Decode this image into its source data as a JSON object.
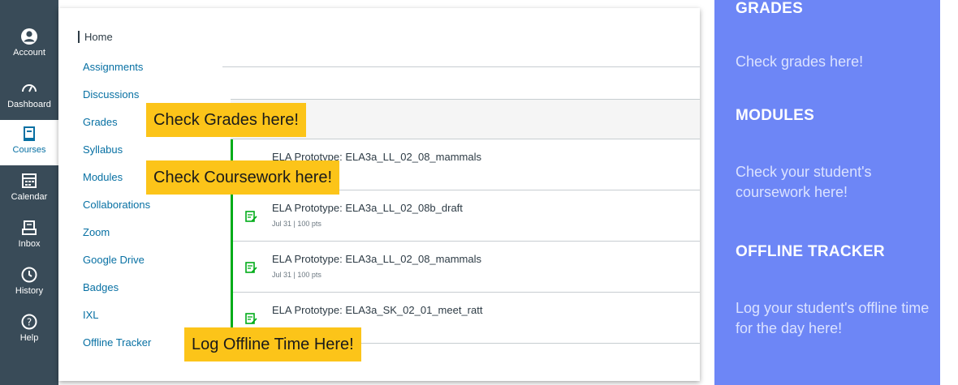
{
  "global_nav": [
    {
      "key": "account",
      "label": "Account",
      "icon": "account-icon"
    },
    {
      "key": "dashboard",
      "label": "Dashboard",
      "icon": "dashboard-icon"
    },
    {
      "key": "courses",
      "label": "Courses",
      "icon": "courses-icon",
      "active": true
    },
    {
      "key": "calendar",
      "label": "Calendar",
      "icon": "calendar-icon"
    },
    {
      "key": "inbox",
      "label": "Inbox",
      "icon": "inbox-icon"
    },
    {
      "key": "history",
      "label": "History",
      "icon": "history-icon"
    },
    {
      "key": "help",
      "label": "Help",
      "icon": "help-icon"
    }
  ],
  "course_nav": [
    {
      "label": "Home",
      "active": true
    },
    {
      "label": "Assignments"
    },
    {
      "label": "Discussions"
    },
    {
      "label": "Grades"
    },
    {
      "label": "Syllabus"
    },
    {
      "label": "Modules"
    },
    {
      "label": "Collaborations"
    },
    {
      "label": "Zoom"
    },
    {
      "label": "Google Drive"
    },
    {
      "label": "Badges"
    },
    {
      "label": "IXL"
    },
    {
      "label": "Offline Tracker"
    }
  ],
  "modules": [
    {
      "title": "ELA Prototype: ELA3a_LL_02_08_mammals",
      "meta": ""
    },
    {
      "title": "ELA Prototype: ELA3a_LL_02_08b_draft",
      "meta": "Jul 31  |  100 pts"
    },
    {
      "title": "ELA Prototype: ELA3a_LL_02_08_mammals",
      "meta": "Jul 31  |  100 pts"
    },
    {
      "title": "ELA Prototype: ELA3a_SK_02_01_meet_ratt",
      "meta": ""
    }
  ],
  "callouts": {
    "grades": "Check Grades here!",
    "coursework": "Check Coursework here!",
    "offline": "Log Offline Time Here!"
  },
  "info_panel": {
    "grades_heading": "GRADES",
    "grades_text": "Check grades here!",
    "modules_heading": "MODULES",
    "modules_text": "Check your student's coursework here!",
    "offline_heading": "OFFLINE TRACKER",
    "offline_text": "Log your student's offline time for the day here!"
  },
  "colors": {
    "nav_bg": "#394b58",
    "link": "#0770a3",
    "callout": "#fcc419",
    "panel": "#6d86f6",
    "module_bar": "#00ac18"
  }
}
